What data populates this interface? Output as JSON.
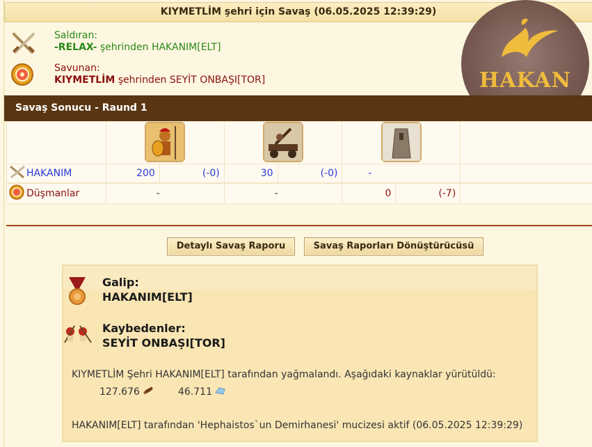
{
  "battle": {
    "title": "KIYMETLİM şehri için Savaş (06.05.2025 12:39:29)",
    "attacker": {
      "role": "Saldıran:",
      "city": "-RELAX-",
      "middle": " şehrinden ",
      "player": "HAKANIM[ELT]"
    },
    "defender": {
      "role": "Savunan:",
      "city": "KIYMETLİM",
      "middle": " şehrinden ",
      "player": "SEYİT ONBAŞI[TOR]"
    },
    "result_header": "Savaş Sonucu - Raund 1"
  },
  "logo": {
    "text": "HAKAN"
  },
  "units": {
    "types": [
      "hoplite-unit",
      "catapult-unit",
      "city-wall-unit"
    ],
    "attacker_row": {
      "name": "HAKANIM",
      "cells": [
        {
          "count": "200",
          "loss": "(-0)"
        },
        {
          "count": "30",
          "loss": "(-0)"
        },
        {
          "count": "-",
          "loss": ""
        }
      ]
    },
    "defender_row": {
      "name": "Düşmanlar",
      "cells": [
        {
          "count": "-",
          "loss": ""
        },
        {
          "count": "-",
          "loss": ""
        },
        {
          "count": "0",
          "loss": "(-7)"
        }
      ]
    }
  },
  "buttons": {
    "detailed_report": "Detaylı Savaş Raporu",
    "report_converter": "Savaş Raporları Dönüştürücüsü"
  },
  "summary": {
    "winner_label": "Galip:",
    "winner_name": "HAKANIM[ELT]",
    "losers_label": "Kaybedenler:",
    "losers_name": "SEYİT ONBAŞI[TOR]",
    "plunder_text": "KIYMETLİM Şehri HAKANIM[ELT] tarafından yağmalandı. Aşağıdaki kaynaklar yürütüldü:",
    "resources": [
      {
        "amount": "127.676",
        "icon": "wood-icon"
      },
      {
        "amount": "46.711",
        "icon": "marble-icon"
      }
    ],
    "wonder_text": "HAKANIM[ELT] tarafından 'Hephaistos`un Demirhanesi' mucizesi aktif (06.05.2025 12:39:29)"
  },
  "colors": {
    "attacker_green": "#2a8a1a",
    "defender_red": "#8a1010",
    "header_brown": "#5a3512",
    "unit_blue": "#2a3ad8"
  }
}
